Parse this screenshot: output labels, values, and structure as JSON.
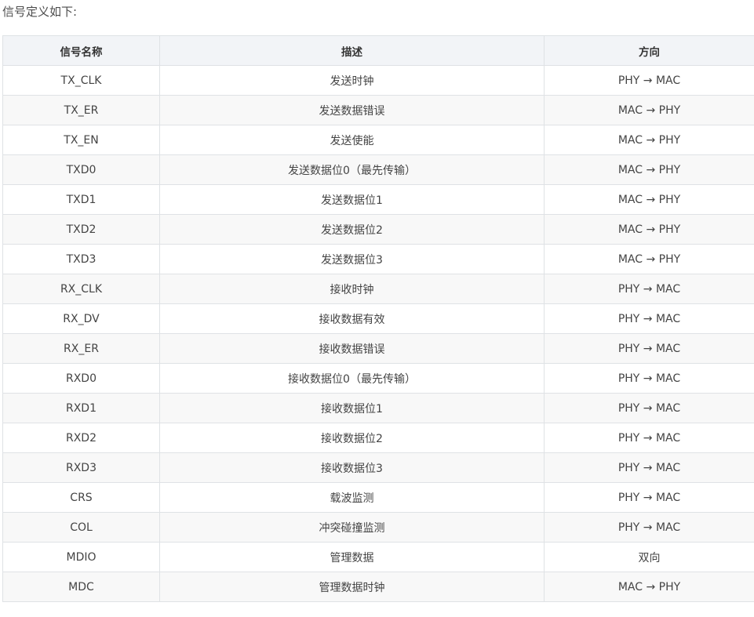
{
  "intro": "信号定义如下:",
  "table": {
    "headers": [
      "信号名称",
      "描述",
      "方向"
    ],
    "rows": [
      [
        "TX_CLK",
        "发送时钟",
        "PHY → MAC"
      ],
      [
        "TX_ER",
        "发送数据错误",
        "MAC → PHY"
      ],
      [
        "TX_EN",
        "发送使能",
        "MAC → PHY"
      ],
      [
        "TXD0",
        "发送数据位0（最先传输）",
        "MAC → PHY"
      ],
      [
        "TXD1",
        "发送数据位1",
        "MAC → PHY"
      ],
      [
        "TXD2",
        "发送数据位2",
        "MAC → PHY"
      ],
      [
        "TXD3",
        "发送数据位3",
        "MAC → PHY"
      ],
      [
        "RX_CLK",
        "接收时钟",
        "PHY → MAC"
      ],
      [
        "RX_DV",
        "接收数据有效",
        "PHY → MAC"
      ],
      [
        "RX_ER",
        "接收数据错误",
        "PHY → MAC"
      ],
      [
        "RXD0",
        "接收数据位0（最先传输）",
        "PHY → MAC"
      ],
      [
        "RXD1",
        "接收数据位1",
        "PHY → MAC"
      ],
      [
        "RXD2",
        "接收数据位2",
        "PHY → MAC"
      ],
      [
        "RXD3",
        "接收数据位3",
        "PHY → MAC"
      ],
      [
        "CRS",
        "载波监测",
        "PHY → MAC"
      ],
      [
        "COL",
        "冲突碰撞监测",
        "PHY → MAC"
      ],
      [
        "MDIO",
        "管理数据",
        "双向"
      ],
      [
        "MDC",
        "管理数据时钟",
        "MAC → PHY"
      ]
    ]
  }
}
